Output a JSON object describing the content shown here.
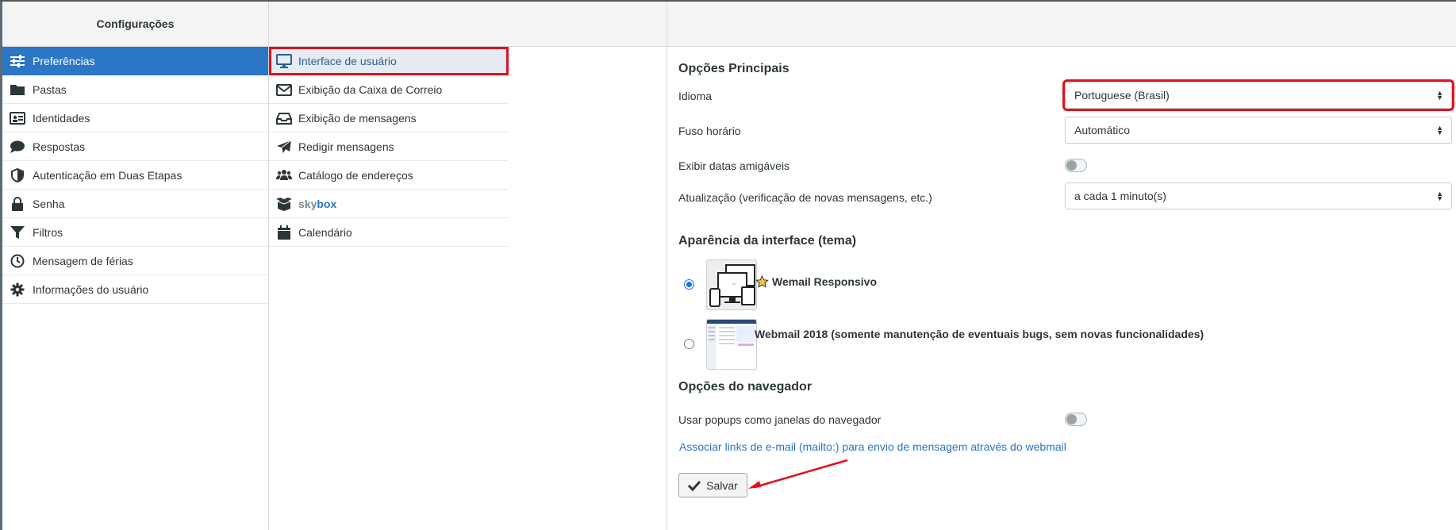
{
  "settings_title": "Configurações",
  "sections": [
    {
      "label": "Preferências",
      "icon": "sliders-icon",
      "active": true
    },
    {
      "label": "Pastas",
      "icon": "folder-icon"
    },
    {
      "label": "Identidades",
      "icon": "id-card-icon"
    },
    {
      "label": "Respostas",
      "icon": "comment-icon"
    },
    {
      "label": "Autenticação em Duas Etapas",
      "icon": "shield-icon"
    },
    {
      "label": "Senha",
      "icon": "lock-icon"
    },
    {
      "label": "Filtros",
      "icon": "filter-icon"
    },
    {
      "label": "Mensagem de férias",
      "icon": "clock-icon"
    },
    {
      "label": "Informações do usuário",
      "icon": "gear-icon"
    }
  ],
  "subsections": [
    {
      "label": "Interface de usuário",
      "icon": "monitor-icon",
      "selected": true
    },
    {
      "label": "Exibição da Caixa de Correio",
      "icon": "envelope-icon"
    },
    {
      "label": "Exibição de mensagens",
      "icon": "inbox-icon"
    },
    {
      "label": "Redigir mensagens",
      "icon": "paper-plane-icon"
    },
    {
      "label": "Catálogo de endereços",
      "icon": "users-icon"
    },
    {
      "label_sky": "sky",
      "label_box": "box",
      "icon": "box-icon"
    },
    {
      "label": "Calendário",
      "icon": "calendar-icon"
    }
  ],
  "main": {
    "main_options_title": "Opções Principais",
    "language_label": "Idioma",
    "language_value": "Portuguese (Brasil)",
    "timezone_label": "Fuso horário",
    "timezone_value": "Automático",
    "friendly_dates_label": "Exibir datas amigáveis",
    "refresh_label": "Atualização (verificação de novas mensagens, etc.)",
    "refresh_value": "a cada 1 minuto(s)",
    "theme_title": "Aparência da interface (tema)",
    "themes": [
      {
        "name": "Wemail Responsivo",
        "checked": true
      },
      {
        "name": "Webmail 2018 (somente manutenção de eventuais bugs, sem novas funcionalidades)",
        "checked": false
      }
    ],
    "browser_options_title": "Opções do navegador",
    "popups_label": "Usar popups como janelas do navegador",
    "mailto_link": "Associar links de e-mail (mailto:) para envio de mensagem através do webmail",
    "save_label": "Salvar"
  },
  "colors": {
    "accent": "#2b76c5",
    "highlight": "#e2101f",
    "link": "#2b76c5"
  }
}
